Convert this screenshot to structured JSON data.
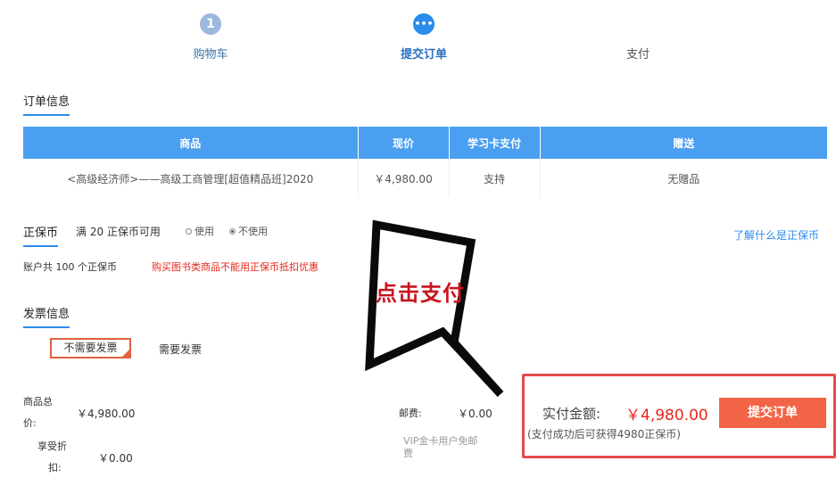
{
  "steps": [
    {
      "number": "1",
      "label": "购物车"
    },
    {
      "number": "•••",
      "label": "提交订单"
    },
    {
      "label": "支付"
    }
  ],
  "order_info": {
    "title": "订单信息",
    "columns": [
      "商品",
      "现价",
      "学习卡支付",
      "赠送"
    ],
    "rows": [
      {
        "product": "<高级经济师>——高级工商管理[超值精品班]2020",
        "price": "￥4,980.00",
        "card": "支持",
        "gift": "无赠品"
      }
    ]
  },
  "coins": {
    "title": "正保币",
    "available_text": "满 20 正保币可用",
    "use_label": "使用",
    "not_use_label": "不使用",
    "what_link": "了解什么是正保币",
    "account_text": "账户共 100 个正保币",
    "warning": "购买图书类商品不能用正保币抵扣优惠"
  },
  "invoice": {
    "title": "发票信息",
    "no_invoice": "不需要发票",
    "need_invoice": "需要发票"
  },
  "summary": {
    "goods_total_label_1": "商品总",
    "goods_total_label_2": "价:",
    "goods_total_value": "￥4,980.00",
    "discount_label_1": "享受折",
    "discount_label_2": "扣:",
    "discount_value": "￥0.00",
    "postage_label": "邮费:",
    "postage_value": "￥0.00",
    "vip_note_1": "VIP金卡用户免邮",
    "vip_note_2": "费"
  },
  "payment": {
    "amount_label": "实付金额:",
    "amount_value": "￥4,980.00",
    "reward_note": "(支付成功后可获得4980正保币)",
    "submit_label": "提交订单"
  },
  "callout": {
    "text": "点击支付"
  },
  "colors": {
    "accent": "#2a8ceb",
    "table_header": "#4a9ff0",
    "price_red": "#e8271c",
    "submit": "#f26446",
    "highlight_box": "#e54b4b"
  }
}
